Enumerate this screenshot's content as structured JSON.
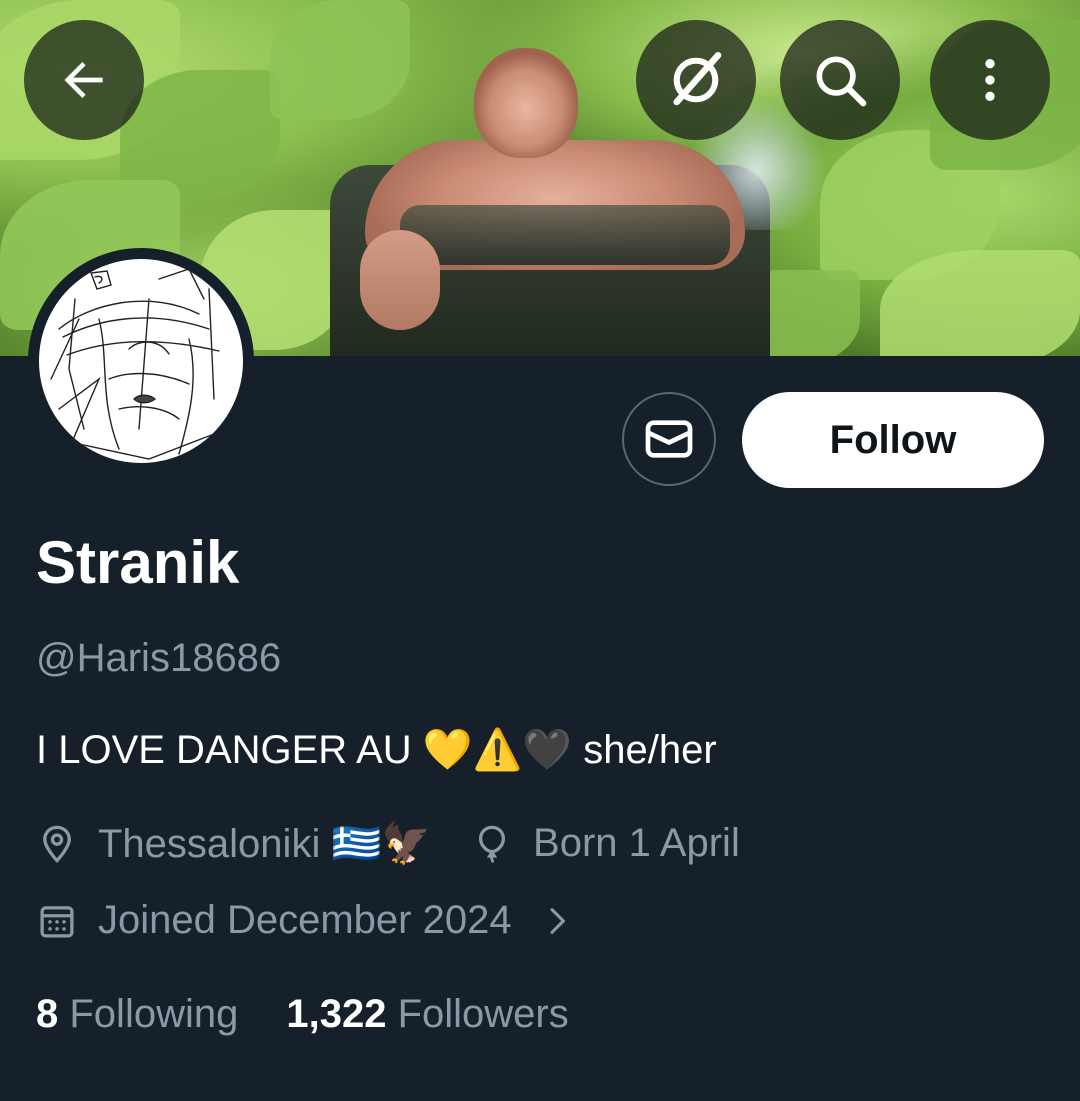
{
  "profile": {
    "display_name": "Stranik",
    "handle": "@Haris18686",
    "bio": "I LOVE DANGER AU 💛⚠️🖤 she/her",
    "location": "Thessaloniki 🇬🇷🦅",
    "birthday": "Born 1 April",
    "joined": "Joined December 2024"
  },
  "actions": {
    "follow_label": "Follow"
  },
  "stats": {
    "following_count": "8",
    "following_label": "Following",
    "followers_count": "1,322",
    "followers_label": "Followers"
  },
  "icons": {
    "back": "arrow-left-icon",
    "grok": "grok-icon",
    "search": "search-icon",
    "more": "more-vertical-icon",
    "message": "envelope-icon",
    "location": "location-pin-icon",
    "birthday": "balloon-icon",
    "joined": "calendar-icon",
    "chevron": "chevron-right-icon"
  },
  "colors": {
    "background": "#16202a",
    "secondary_text": "#8b98a5",
    "primary_text": "#ffffff",
    "follow_button_bg": "#ffffff"
  }
}
